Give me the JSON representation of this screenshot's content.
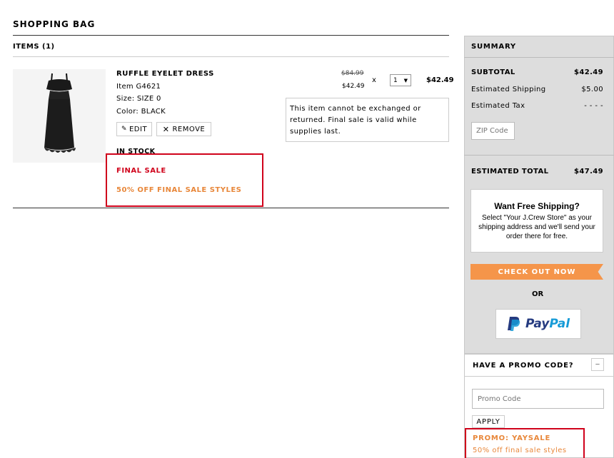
{
  "bag": {
    "title": "SHOPPING BAG",
    "items_heading": "ITEMS (1)"
  },
  "item": {
    "name": "RUFFLE EYELET DRESS",
    "item_no": "Item G4621",
    "size": "Size: SIZE 0",
    "color": "Color: BLACK",
    "edit_label": "EDIT",
    "remove_label": "REMOVE",
    "stock": "IN STOCK",
    "final_sale": "FINAL SALE",
    "promo_note": "50% OFF FINAL SALE STYLES",
    "price_original": "$84.99",
    "price_sale": "$42.49",
    "qty_x": "x",
    "quantity": "1",
    "line_total": "$42.49",
    "notice": "This item cannot be exchanged or returned. Final sale is valid while supplies last."
  },
  "summary": {
    "title": "SUMMARY",
    "subtotal_label": "SUBTOTAL",
    "subtotal_value": "$42.49",
    "shipping_label": "Estimated Shipping",
    "shipping_value": "$5.00",
    "tax_label": "Estimated Tax",
    "tax_value": "- - - -",
    "zip_placeholder": "ZIP Code",
    "total_label": "ESTIMATED TOTAL",
    "total_value": "$47.49",
    "free_ship_title": "Want Free Shipping?",
    "free_ship_body": "Select \"Your J.Crew Store\" as your shipping address and we'll send your order there for free.",
    "checkout_label": "CHECK OUT NOW",
    "or_label": "OR",
    "paypal_pay": "Pay",
    "paypal_pal": "Pal"
  },
  "promo": {
    "heading": "HAVE A PROMO CODE?",
    "toggle": "−",
    "placeholder": "Promo Code",
    "apply_label": "APPLY",
    "applied_code": "PROMO: YAYSALE",
    "applied_desc": "50% off final sale styles"
  },
  "colors": {
    "sale_red": "#d0021b",
    "promo_orange": "#e8873a",
    "checkout_orange": "#f5954a",
    "paypal_dark": "#253b80",
    "paypal_light": "#179bd7"
  }
}
